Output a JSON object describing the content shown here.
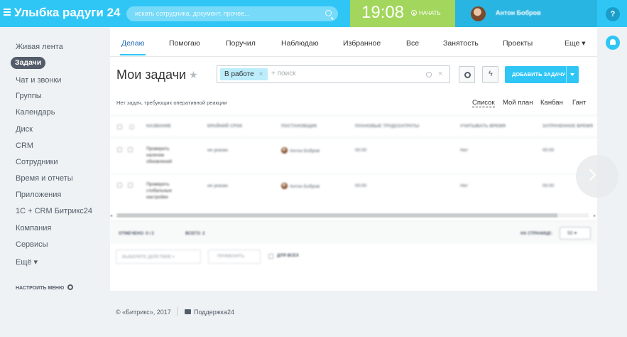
{
  "header": {
    "logo_main": "Улыбка радуги",
    "logo_num": "24",
    "search_placeholder": "искать сотрудника, документ, прочее...",
    "clock": "19:08",
    "start_label": "НАЧАТЬ",
    "user_name": "Антон Бобров",
    "help_label": "?"
  },
  "sidebar": {
    "items": [
      {
        "label": "Живая лента"
      },
      {
        "label": "Задачи",
        "active": true
      },
      {
        "label": "Чат и звонки"
      },
      {
        "label": "Группы"
      },
      {
        "label": "Календарь"
      },
      {
        "label": "Диск"
      },
      {
        "label": "CRM"
      },
      {
        "label": "Сотрудники"
      },
      {
        "label": "Время и отчеты"
      },
      {
        "label": "Приложения"
      },
      {
        "label": "1С + CRM Битрикс24"
      },
      {
        "label": "Компания"
      },
      {
        "label": "Сервисы"
      },
      {
        "label": "Ещё ▾"
      }
    ],
    "setup_label": "НАСТРОИТЬ МЕНЮ"
  },
  "tabs": [
    {
      "label": "Делаю",
      "active": true
    },
    {
      "label": "Помогаю"
    },
    {
      "label": "Поручил"
    },
    {
      "label": "Наблюдаю"
    },
    {
      "label": "Избранное"
    },
    {
      "label": "Все"
    },
    {
      "label": "Занятость"
    },
    {
      "label": "Проекты"
    },
    {
      "label": "Еще ▾"
    }
  ],
  "page": {
    "title": "Мои задачи",
    "star": "★",
    "filter_chip": "В работе",
    "filter_chip_close": "×",
    "filter_placeholder": "+ поиск",
    "filter_clear": "×",
    "add_task_label": "ДОБАВИТЬ ЗАДАЧУ",
    "bolt": "ϟ",
    "no_tasks_text": "Нет задач, требующих оперативной реакции",
    "views": [
      "Список",
      "Мой план",
      "Канбан",
      "Гант"
    ]
  },
  "grid": {
    "columns": [
      "НАЗВАНИЕ",
      "КРАЙНИЙ СРОК",
      "ПОСТАНОВЩИК",
      "ПЛАНОВЫЕ ТРУДОЗАТРАТЫ",
      "УЧИТЫВАТЬ ВРЕМЯ",
      "ЗАТРАЧЕННОЕ ВРЕМЯ"
    ],
    "rows": [
      {
        "name_l1": "Проверить",
        "name_l2": "наличие",
        "name_l3": "обновлений",
        "deadline": "не указан",
        "creator": "Антон Бобров",
        "planned": "00:00",
        "track_time": "Нет",
        "spent": "00:00"
      },
      {
        "name_l1": "Проверить",
        "name_l2": "глобальные",
        "name_l3": "настройки",
        "deadline": "не указан",
        "creator": "Антон Бобров",
        "planned": "00:00",
        "track_time": "Нет",
        "spent": "00:00"
      }
    ]
  },
  "footer": {
    "selected": "ОТМЕЧЕНО: 0 / 2",
    "total": "ВСЕГО: 2",
    "per_page_label": "НА СТРАНИЦЕ:",
    "per_page_value": "50",
    "action_select": "ВЫБЕРИТЕ ДЕЙСТВИЕ",
    "apply_label": "ПРИМЕНИТЬ",
    "for_all_label": "ДЛЯ ВСЕХ"
  },
  "bottom": {
    "copyright": "© «Битрикс», 2017",
    "support": "Поддержка24"
  }
}
